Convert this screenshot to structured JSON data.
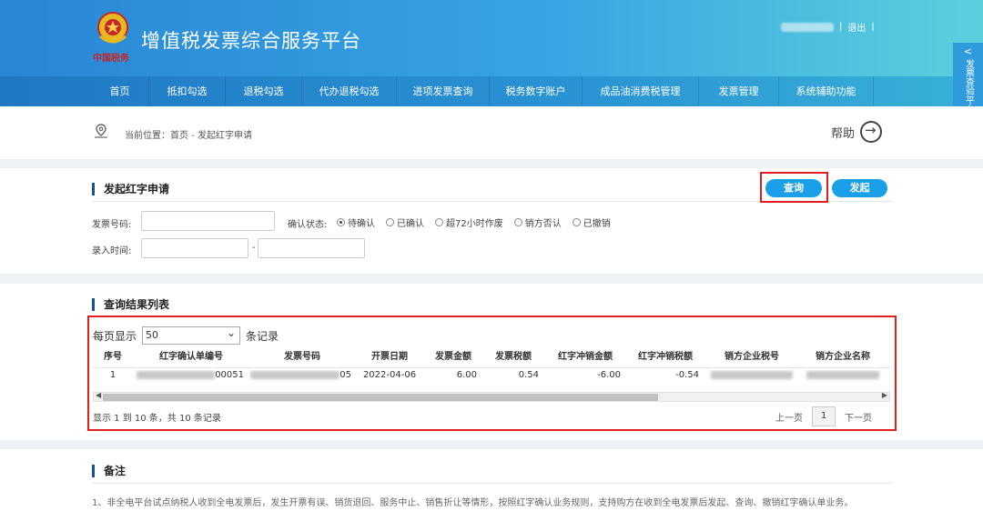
{
  "header": {
    "logo_caption": "中国税务",
    "title": "增值税发票综合服务平台",
    "separator": "|",
    "logout": "退出"
  },
  "nav": {
    "items": [
      {
        "label": "首页"
      },
      {
        "label": "抵扣勾选"
      },
      {
        "label": "退税勾选"
      },
      {
        "label": "代办退税勾选"
      },
      {
        "label": "进项发票查询"
      },
      {
        "label": "税务数字账户"
      },
      {
        "label": "成品油消费税管理"
      },
      {
        "label": "发票管理"
      },
      {
        "label": "系统辅助功能"
      }
    ]
  },
  "side_tab": {
    "chevron": "<",
    "label": "发票查验平台"
  },
  "breadcrumb": {
    "text": "当前位置：首页 - 发起红字申请"
  },
  "help": {
    "label": "帮助"
  },
  "apply": {
    "title": "发起红字申请",
    "query_button": "查询",
    "launch_button": "发起",
    "invoice_no_label": "发票号码:",
    "status_label": "确认状态:",
    "statuses": [
      "待确认",
      "已确认",
      "超72小时作废",
      "销方否认",
      "已撤销"
    ],
    "selected_status": "待确认",
    "time_label": "录入时间:",
    "range_sep": "-"
  },
  "results": {
    "title": "查询结果列表",
    "per_page_prefix": "每页显示",
    "per_page_value": "50",
    "per_page_suffix": "条记录",
    "columns": [
      "序号",
      "红字确认单编号",
      "发票号码",
      "开票日期",
      "发票金额",
      "发票税额",
      "红字冲销金额",
      "红字冲销税额",
      "销方企业税号",
      "销方企业名称"
    ],
    "rows": [
      {
        "no": "1",
        "confirm_no_tail": "00051",
        "invoice_no_tail": "05",
        "date": "2022-04-06",
        "amount": "6.00",
        "tax": "0.54",
        "red_amount": "-6.00",
        "red_tax": "-0.54"
      }
    ],
    "summary": "显示 1 到 10 条，共 10 条记录",
    "prev": "上一页",
    "page": "1",
    "next": "下一页"
  },
  "notes": {
    "title": "备注",
    "text": "1、非全电平台试点纳税人收到全电发票后，发生开票有误、销货退回、服务中止、销售折让等情形，按照红字确认业务规则，支持购方在收到全电发票后发起、查询、撤销红字确认单业务。"
  },
  "colors": {
    "header_start": "#2a86d6",
    "header_end": "#5bd0dc",
    "button": "#1a9fe8",
    "highlight": "#e02020",
    "section_bar": "#1b4f9a"
  }
}
